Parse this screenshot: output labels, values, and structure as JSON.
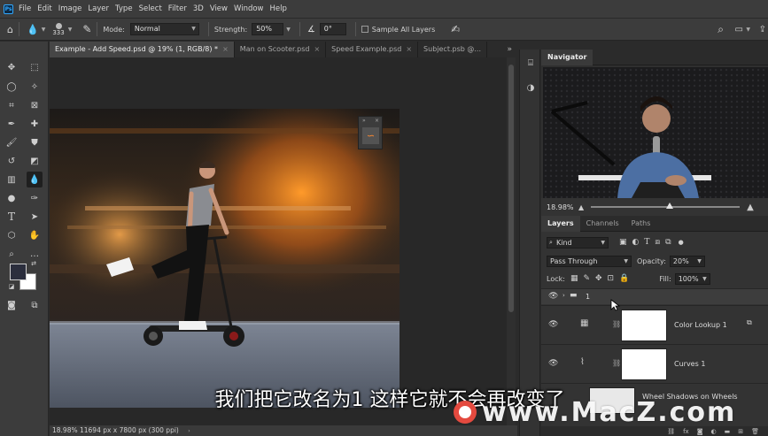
{
  "app": {
    "logo_label": "Ps"
  },
  "menu": [
    "File",
    "Edit",
    "Image",
    "Layer",
    "Type",
    "Select",
    "Filter",
    "3D",
    "View",
    "Window",
    "Help"
  ],
  "options_bar": {
    "brush_size": "333",
    "mode_label": "Mode:",
    "mode_value": "Normal",
    "strength_label": "Strength:",
    "strength_value": "50%",
    "angle_value": "0°",
    "sample_all_layers": "Sample All Layers"
  },
  "tabs": [
    {
      "label": "Example - Add Speed.psd @ 19% (1, RGB/8) *",
      "active": true
    },
    {
      "label": "Man on Scooter.psd",
      "active": false
    },
    {
      "label": "Speed Example.psd",
      "active": false
    },
    {
      "label": "Subject.psb @...",
      "active": false
    }
  ],
  "status_bar": {
    "text": "18.98%   11694 px x 7800 px (300 ppi)"
  },
  "navigator": {
    "title": "Navigator",
    "zoom": "18.98%"
  },
  "layers_panel": {
    "tabs": [
      "Layers",
      "Channels",
      "Paths"
    ],
    "filter_value": "Kind",
    "blend_mode": "Pass Through",
    "opacity_label": "Opacity:",
    "opacity_value": "20%",
    "lock_label": "Lock:",
    "fill_label": "Fill:",
    "fill_value": "100%",
    "layers": [
      {
        "name": "1",
        "type": "group"
      },
      {
        "name": "Color Lookup 1",
        "type": "adjustment",
        "icon": "grid-icon"
      },
      {
        "name": "Curves 1",
        "type": "adjustment",
        "icon": "curves-icon"
      },
      {
        "name": "Wheel Shadows on Wheels",
        "type": "pixel"
      }
    ],
    "footer_icons": [
      "link-icon",
      "fx-icon",
      "mask-icon",
      "adjustment-icon",
      "folder-icon",
      "new-layer-icon",
      "trash-icon"
    ],
    "footer_fx_label": "fx"
  },
  "subtitle": "我们把它改名为1 这样它就不会再改变了",
  "watermark": "www.MacZ.com"
}
